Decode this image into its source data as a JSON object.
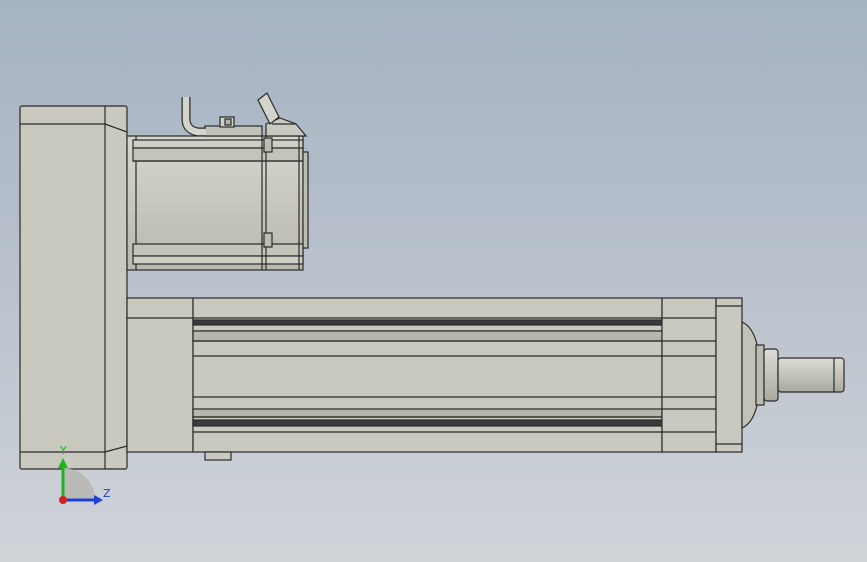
{
  "scene": {
    "background_top": "#a6b3c3",
    "background_bottom": "#d0d4d9",
    "body_color": "#c9c9c0",
    "shade_color": "#b4b4ab",
    "edge_color": "#2a2a2a"
  },
  "triad": {
    "y_label": "Y",
    "z_label": "Z",
    "y_color": "#1fb31f",
    "z_color": "#1f3fd6",
    "x_color": "#d21f1f"
  }
}
